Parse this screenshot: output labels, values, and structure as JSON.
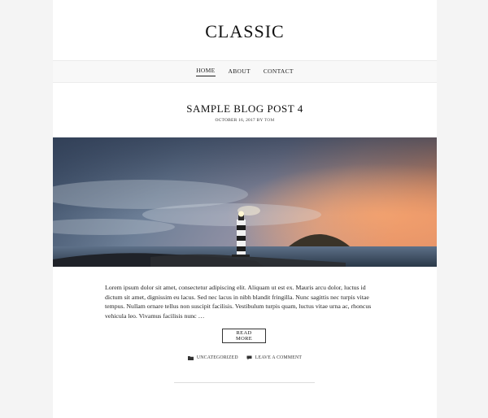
{
  "site": {
    "title": "CLASSIC"
  },
  "nav": {
    "items": [
      "HOME",
      "ABOUT",
      "CONTACT"
    ]
  },
  "post": {
    "title": "SAMPLE BLOG POST 4",
    "date": "OCTOBER 16, 2017",
    "by": "BY",
    "author": "TOM",
    "excerpt": "Lorem ipsum dolor sit amet, consectetur adipiscing elit. Aliquam ut est ex. Mauris arcu dolor, luctus id dictum sit amet, dignissim eu lacus. Sed nec lacus in nibh blandit fringilla. Nunc sagittis nec turpis vitae tempus. Nullam ornare tellus non suscipit facilisis. Vestibulum turpis quam, luctus vitae urna ac, rhoncus vehicula leo. Vivamus facilisis nunc …",
    "read_more": "READ MORE",
    "category": "UNCATEGORIZED",
    "comment_link": "LEAVE A COMMENT"
  },
  "icons": {
    "category": "folder-icon",
    "comment": "comment-icon"
  }
}
